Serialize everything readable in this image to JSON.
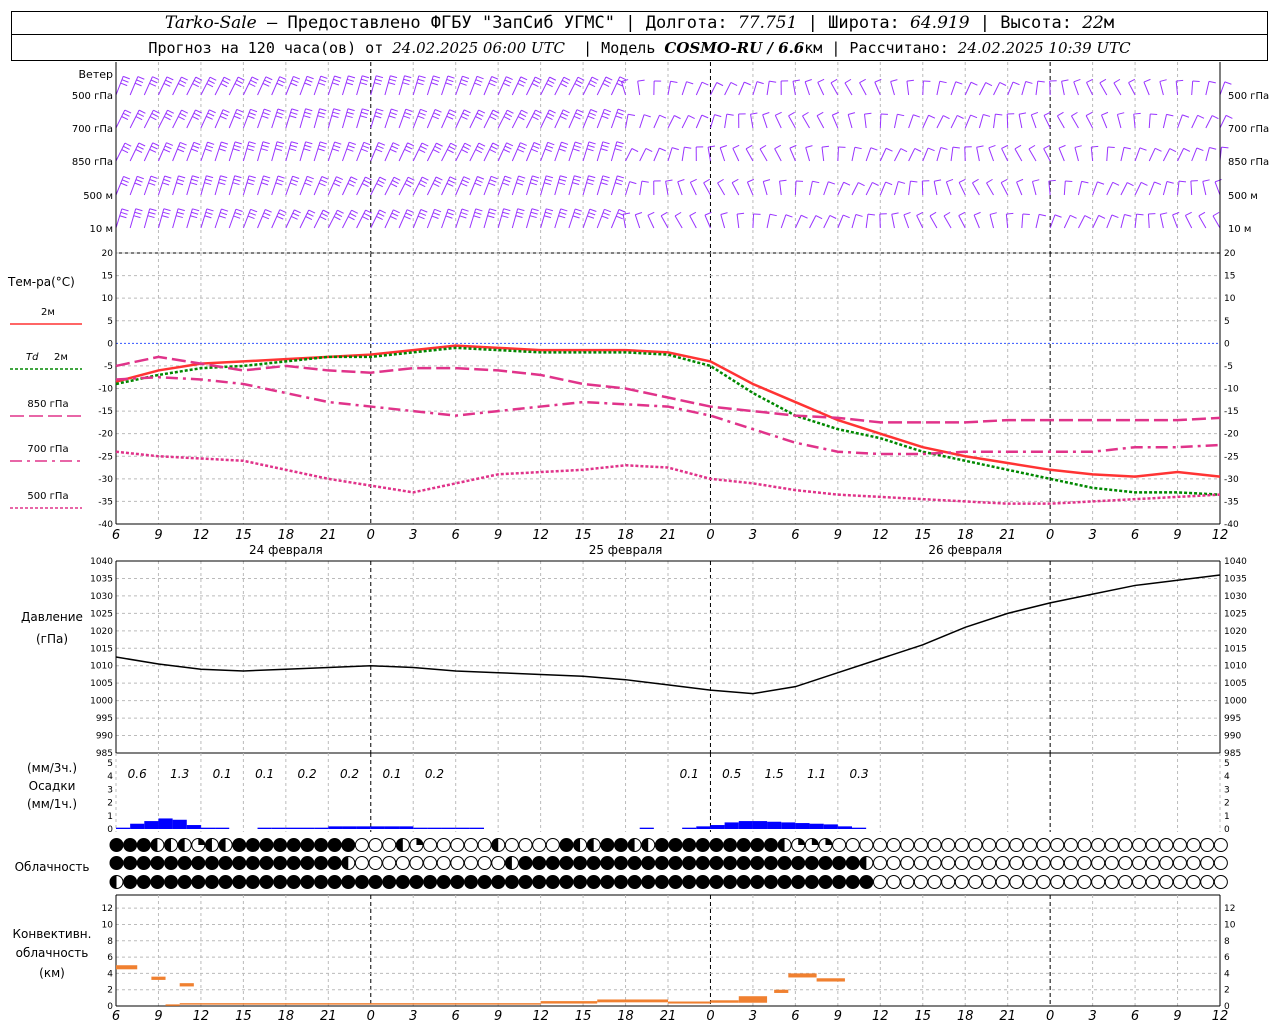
{
  "header": {
    "station": "Tarko-Sale",
    "dash": "–",
    "provider": "Предоставлено ФГБУ \"ЗапСиб УГМС\"",
    "lon_label": "Долгота:",
    "lon_value": "77.751",
    "lat_label": "Широта:",
    "lat_value": "64.919",
    "alt_label": "Высота:",
    "alt_value": "22",
    "alt_unit": "м",
    "forecast_label": "Прогноз на 120 часа(ов) от",
    "forecast_date": "24.02.2025 06:00 UTC",
    "model_label": "Модель",
    "model_value": "COSMO-RU / 6.6",
    "model_unit": "км",
    "calc_label": "Рассчитано:",
    "calc_date": "24.02.2025 10:39 UTC",
    "sep": "|"
  },
  "chart_data": [
    {
      "type": "wind_barbs",
      "title": "Ветер",
      "levels": [
        "500 гПа",
        "700 гПа",
        "850 гПа",
        "500 м",
        "10  м"
      ],
      "color": "#9933ff"
    },
    {
      "type": "line",
      "ylabel": "Тем-ра(°C)",
      "ylim": [
        -40,
        20
      ],
      "yticks": [
        20,
        15,
        10,
        5,
        0,
        -5,
        -10,
        -15,
        -20,
        -25,
        -30,
        -35,
        -40
      ],
      "x_hours": [
        0,
        3,
        6,
        9,
        12,
        15,
        18,
        21,
        24,
        27,
        30,
        33,
        36,
        39,
        42,
        45,
        48,
        51,
        54,
        57,
        60,
        63,
        66,
        69,
        72,
        75,
        78
      ],
      "legend_prefix": "Td",
      "series": [
        {
          "name": "2м",
          "color": "#ff3333",
          "dash": "solid",
          "values": [
            -8.5,
            -6,
            -4.5,
            -4,
            -3.5,
            -3,
            -2.5,
            -1.5,
            -0.5,
            -1,
            -1.5,
            -1.5,
            -1.5,
            -2,
            -4,
            -9,
            -13,
            -17,
            -20,
            -23,
            -25,
            -26.5,
            -28,
            -29,
            -29.5,
            -28.5,
            -29.5
          ]
        },
        {
          "name": "2м",
          "color": "#008800",
          "dash": "dot",
          "values": [
            -9,
            -7,
            -5.5,
            -5,
            -4,
            -3,
            -3,
            -2,
            -1,
            -1.5,
            -2,
            -2,
            -2,
            -2.5,
            -5,
            -11,
            -16,
            -19,
            -21,
            -24,
            -26,
            -28,
            -30,
            -32,
            -33,
            -33,
            -33.5
          ]
        },
        {
          "name": "850 гПа",
          "color": "#e0338a",
          "dash": "longdash",
          "values": [
            -5,
            -3,
            -4.5,
            -6,
            -5,
            -6,
            -6.5,
            -5.5,
            -5.5,
            -6,
            -7,
            -9,
            -10,
            -12,
            -14,
            -15,
            -16,
            -16.5,
            -17.5,
            -17.5,
            -17.5,
            -17,
            -17,
            -17,
            -17,
            -17,
            -16.5
          ]
        },
        {
          "name": "700 гПа",
          "color": "#e0338a",
          "dash": "dashdot",
          "values": [
            -8,
            -7.5,
            -8,
            -9,
            -11,
            -13,
            -14,
            -15,
            -16,
            -15,
            -14,
            -13,
            -13.5,
            -14,
            -16,
            -19,
            -22,
            -24,
            -24.5,
            -24.5,
            -24,
            -24,
            -24,
            -24,
            -23,
            -23,
            -22.5
          ]
        },
        {
          "name": "500 гПа",
          "color": "#e0338a",
          "dash": "dot",
          "values": [
            -24,
            -25,
            -25.5,
            -26,
            -28,
            -30,
            -31.5,
            -33,
            -31,
            -29,
            -28.5,
            -28,
            -27,
            -27.5,
            -30,
            -31,
            -32.5,
            -33.5,
            -34,
            -34.5,
            -35,
            -35.5,
            -35.5,
            -35,
            -34.5,
            -34,
            -33.5
          ]
        }
      ],
      "date_labels": [
        "24 февраля",
        "25 февраля",
        "26 февраля"
      ]
    },
    {
      "type": "line",
      "ylabel": "Давление",
      "ylabel_unit": "(гПа)",
      "ylim": [
        985,
        1040
      ],
      "yticks": [
        1040,
        1035,
        1030,
        1025,
        1020,
        1015,
        1010,
        1005,
        1000,
        995,
        990,
        985
      ],
      "x_hours": [
        0,
        3,
        6,
        9,
        12,
        15,
        18,
        21,
        24,
        27,
        30,
        33,
        36,
        39,
        42,
        45,
        48,
        51,
        54,
        57,
        60,
        63,
        66,
        69,
        72,
        75,
        78
      ],
      "series": [
        {
          "color": "#000000",
          "values": [
            1012.5,
            1010.5,
            1009,
            1008.5,
            1009,
            1009.5,
            1010,
            1009.5,
            1008.5,
            1008,
            1007.5,
            1007,
            1006,
            1004.5,
            1003,
            1002,
            1004,
            1008,
            1012,
            1016,
            1021,
            1025,
            1028,
            1030.5,
            1033,
            1034.5,
            1036
          ]
        }
      ]
    },
    {
      "type": "bar",
      "ylabel_top": "(мм/3ч.)",
      "ylabel": "Осадки",
      "ylabel_bottom": "(мм/1ч.)",
      "ylim": [
        0,
        5
      ],
      "yticks": [
        5,
        4,
        3,
        2,
        1,
        0
      ],
      "color": "#0000ff",
      "x_hours": [
        1,
        2,
        3,
        4,
        5,
        6,
        7,
        8,
        9,
        10,
        11,
        12,
        13,
        14,
        15,
        16,
        17,
        18,
        19,
        20,
        21,
        22,
        23,
        24,
        25,
        26,
        27,
        28,
        29,
        30,
        31,
        32,
        33,
        34,
        35,
        36,
        37,
        38,
        39,
        40,
        41,
        42,
        43,
        44,
        45,
        46,
        47,
        48,
        49,
        50,
        51,
        52,
        53,
        54,
        55
      ],
      "values": [
        0.1,
        0.4,
        0.6,
        0.8,
        0.7,
        0.3,
        0.1,
        0.1,
        0,
        0,
        0.1,
        0.1,
        0.1,
        0.1,
        0.1,
        0.2,
        0.2,
        0.2,
        0.2,
        0.2,
        0.2,
        0.1,
        0.1,
        0.1,
        0.1,
        0.1,
        0,
        0,
        0,
        0,
        0,
        0,
        0,
        0,
        0,
        0,
        0,
        0.1,
        0,
        0,
        0.1,
        0.2,
        0.3,
        0.5,
        0.6,
        0.6,
        0.55,
        0.5,
        0.45,
        0.4,
        0.35,
        0.2,
        0.1,
        0,
        0
      ],
      "totals_3h": [
        "0.6",
        "1.3",
        "0.1",
        "0.1",
        "0.2",
        "0.2",
        "0.1",
        "0.2",
        "0.1",
        "0.5",
        "1.5",
        "1.1",
        "0.3"
      ],
      "totals_3h_hours": [
        1.5,
        4.5,
        7.5,
        10.5,
        13.5,
        16.5,
        19.5,
        22.5,
        40.5,
        43.5,
        46.5,
        49.5,
        52.5
      ]
    },
    {
      "type": "cloud_cover",
      "title": "Облачность",
      "rows": [
        "FFFHHHQHHFFFFFFFFFEEEHQEEEEEHEEEEFHHFFHHFFFFFFFFFHQQQEEEEEEEEEEEEEEEEEEEEEEEEEEEEE",
        "FFFFFFFFFFFFFFFFFHEEEEEEEEEEEHFFFFFFFFFFFFFFFFFFFFFFFFFHEEEEEEEEEEEEEEEEEEEEEEEEEE",
        "HFFFFFFFFFFFFFFFFFFFFFFFFFFFFFFFFFFFFFFFFFFFFFFFFFFFFFFFEEEEEEEEEEEEEEEEEEEEEEEEEE"
      ],
      "legend": {
        "F": "full",
        "H": "half",
        "Q": "quarter",
        "E": "clear"
      }
    },
    {
      "type": "bar",
      "ylabel": "Конвективн.",
      "ylabel2": "облачность",
      "ylabel_unit": "(км)",
      "ylim": [
        0,
        13
      ],
      "yticks": [
        12,
        10,
        8,
        6,
        4,
        2,
        0
      ],
      "color": "#f08030",
      "segments": [
        {
          "start": 0,
          "end": 1.5,
          "base": 4.5,
          "top": 5
        },
        {
          "start": 2.5,
          "end": 3.5,
          "base": 3.2,
          "top": 3.6
        },
        {
          "start": 4.5,
          "end": 5.5,
          "base": 2.4,
          "top": 2.8
        },
        {
          "start": 3.5,
          "end": 4.5,
          "base": 0.1,
          "top": 0.2
        },
        {
          "start": 4.5,
          "end": 30,
          "base": 0.2,
          "top": 0.35
        },
        {
          "start": 30,
          "end": 34,
          "base": 0.3,
          "top": 0.6
        },
        {
          "start": 34,
          "end": 39,
          "base": 0.45,
          "top": 0.8
        },
        {
          "start": 39,
          "end": 42,
          "base": 0.3,
          "top": 0.55
        },
        {
          "start": 42,
          "end": 44,
          "base": 0.4,
          "top": 0.7
        },
        {
          "start": 44,
          "end": 46,
          "base": 0.4,
          "top": 1.2
        },
        {
          "start": 46.5,
          "end": 47.5,
          "base": 1.6,
          "top": 2.0
        },
        {
          "start": 47.5,
          "end": 49.5,
          "base": 3.5,
          "top": 4.0
        },
        {
          "start": 49.5,
          "end": 51.5,
          "base": 3.0,
          "top": 3.4
        }
      ]
    }
  ],
  "x_axis": {
    "labels": [
      "6",
      "9",
      "12",
      "15",
      "18",
      "21",
      "0",
      "3",
      "6",
      "9",
      "12",
      "15",
      "18",
      "21",
      "0",
      "3",
      "6",
      "9",
      "12",
      "15",
      "18",
      "21",
      "0",
      "3",
      "6",
      "9",
      "12"
    ]
  }
}
